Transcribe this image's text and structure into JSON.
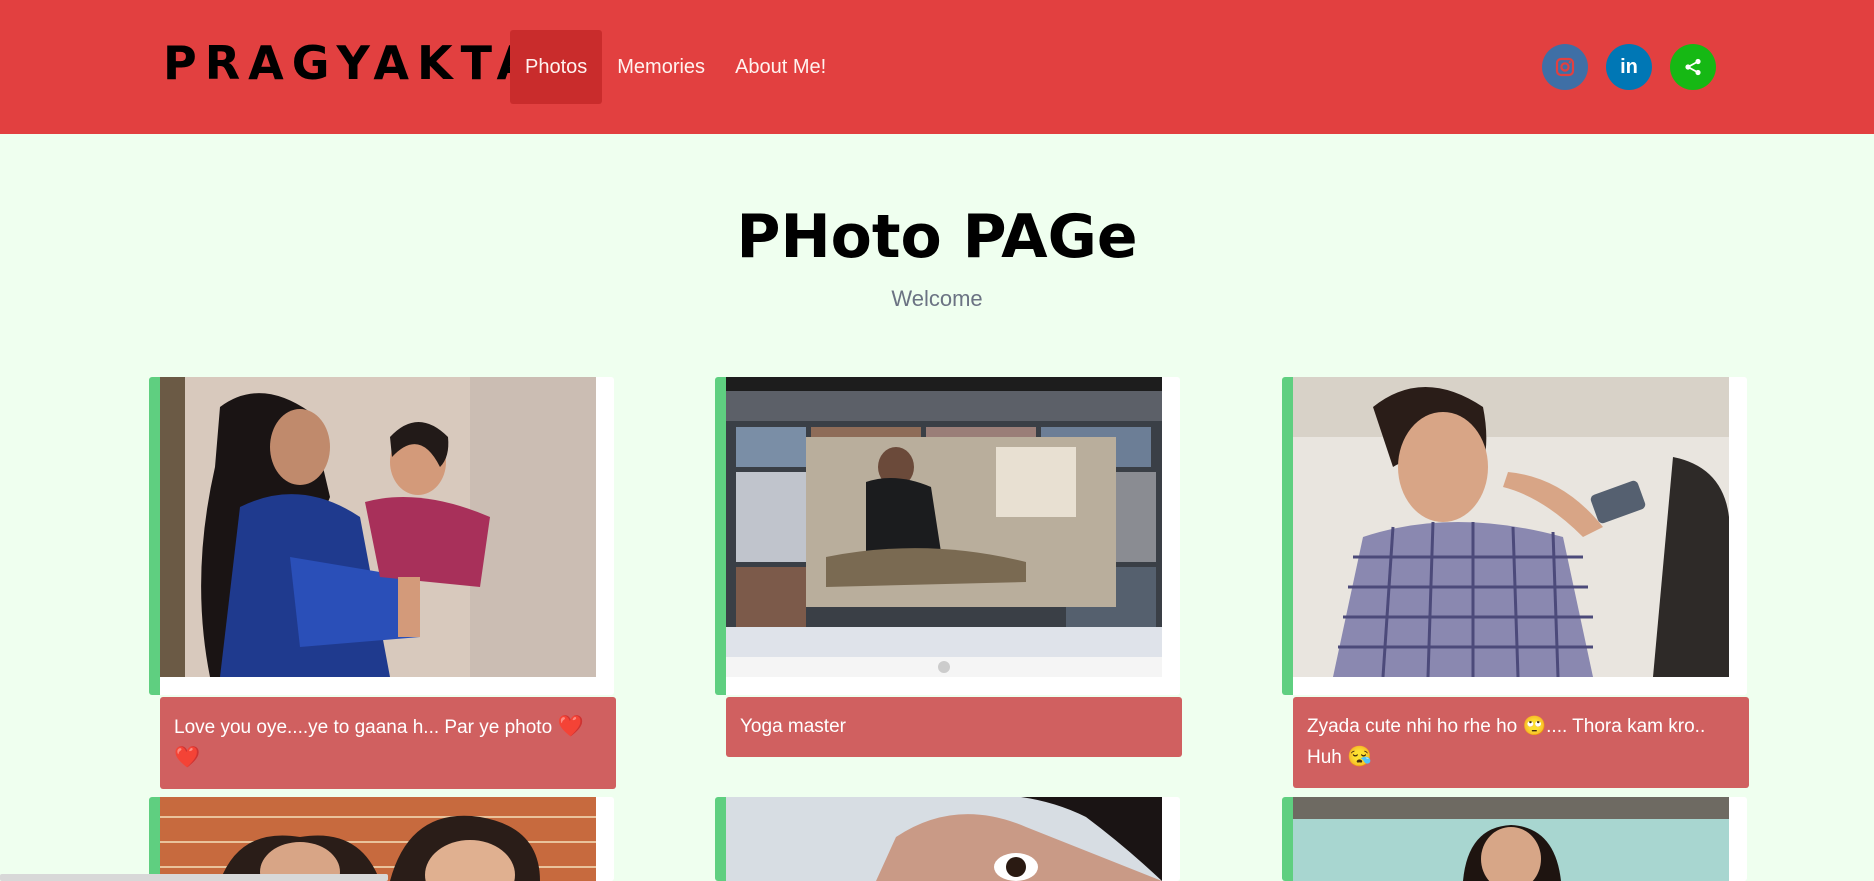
{
  "navbar": {
    "brand": "PRAGYAKTA",
    "links": [
      {
        "label": "Photos",
        "active": true
      },
      {
        "label": "Memories",
        "active": false
      },
      {
        "label": "About Me!",
        "active": false
      }
    ],
    "social": [
      {
        "icon": "instagram-icon",
        "color": "#3f6fa6"
      },
      {
        "icon": "linkedin-icon",
        "glyph": "in",
        "color": "#0077b5"
      },
      {
        "icon": "share-icon",
        "color": "#16b814"
      }
    ],
    "background": "#e24040"
  },
  "hero": {
    "title": "PHoto PAGe",
    "subtitle": "Welcome"
  },
  "cards": [
    {
      "caption": "Love you oye....ye to gaana h... Par ye photo",
      "caption_tail": "❤️ ❤️",
      "photo": "mother-daughter-photo"
    },
    {
      "caption": "Yoga master",
      "caption_tail": "",
      "photo": "yoga-photo"
    },
    {
      "caption": "Zyada cute nhi ho rhe ho 🙄.... Thora kam kro.. Huh",
      "caption_tail": "😪",
      "photo": "girl-eating-photo"
    },
    {
      "caption": "",
      "caption_tail": "",
      "photo": "friends-photo"
    },
    {
      "caption": "",
      "caption_tail": "",
      "photo": "closeup-eyes-photo"
    },
    {
      "caption": "",
      "caption_tail": "",
      "photo": "smiling-girl-photo"
    }
  ],
  "colors": {
    "page_bg": "#efffef",
    "accent_border": "#5fcf80",
    "caption_bg": "#d06060"
  }
}
